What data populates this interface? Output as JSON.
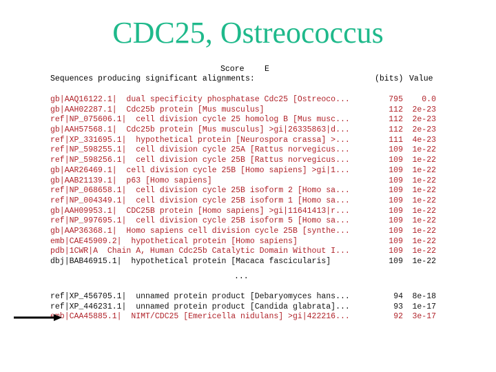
{
  "title": "CDC25, Ostreococcus",
  "header": {
    "line1_score": "Score",
    "line1_e": "E",
    "line2_label": "Sequences producing significant alignments:",
    "line2_bits": "(bits)",
    "line2_value": "Value"
  },
  "colors": {
    "title": "#1fb98b",
    "highlight": "#b0232a",
    "normal": "#111111"
  },
  "hits": [
    {
      "acc": "gb|AAQ16122.1|  dual specificity phosphatase Cdc25 [Ostreoco...",
      "bits": "795",
      "evalue": "0.0",
      "color": "red"
    },
    {
      "acc": "gb|AAH02287.1|  Cdc25b protein [Mus musculus]",
      "bits": "112",
      "evalue": "2e-23",
      "color": "red"
    },
    {
      "acc": "ref|NP_075606.1|  cell division cycle 25 homolog B [Mus musc...",
      "bits": "112",
      "evalue": "2e-23",
      "color": "red"
    },
    {
      "acc": "gb|AAH57568.1|  Cdc25b protein [Mus musculus] >gi|26335863|d...",
      "bits": "112",
      "evalue": "2e-23",
      "color": "red"
    },
    {
      "acc": "ref|XP_331695.1|  hypothetical protein [Neurospora crassa] >...",
      "bits": "111",
      "evalue": "4e-23",
      "color": "red"
    },
    {
      "acc": "ref|NP_598255.1|  cell division cycle 25A [Rattus norvegicus...",
      "bits": "109",
      "evalue": "1e-22",
      "color": "red"
    },
    {
      "acc": "ref|NP_598256.1|  cell division cycle 25B [Rattus norvegicus...",
      "bits": "109",
      "evalue": "1e-22",
      "color": "red"
    },
    {
      "acc": "gb|AAR26469.1|  cell division cycle 25B [Homo sapiens] >gi|1...",
      "bits": "109",
      "evalue": "1e-22",
      "color": "red"
    },
    {
      "acc": "gb|AAB21139.1|  p63 [Homo sapiens]",
      "bits": "109",
      "evalue": "1e-22",
      "color": "red"
    },
    {
      "acc": "ref|NP_068658.1|  cell division cycle 25B isoform 2 [Homo sa...",
      "bits": "109",
      "evalue": "1e-22",
      "color": "red"
    },
    {
      "acc": "ref|NP_004349.1|  cell division cycle 25B isoform 1 [Homo sa...",
      "bits": "109",
      "evalue": "1e-22",
      "color": "red"
    },
    {
      "acc": "gb|AAH09953.1|  CDC25B protein [Homo sapiens] >gi|11641413|r...",
      "bits": "109",
      "evalue": "1e-22",
      "color": "red"
    },
    {
      "acc": "ref|NP_997695.1|  cell division cycle 25B isoform 5 [Homo sa...",
      "bits": "109",
      "evalue": "1e-22",
      "color": "red"
    },
    {
      "acc": "gb|AAP36368.1|  Homo sapiens cell division cycle 25B [synthe...",
      "bits": "109",
      "evalue": "1e-22",
      "color": "red"
    },
    {
      "acc": "emb|CAE45909.2|  hypothetical protein [Homo sapiens]",
      "bits": "109",
      "evalue": "1e-22",
      "color": "red"
    },
    {
      "acc": "pdb|1CWR|A  Chain A, Human Cdc25b Catalytic Domain Without I...",
      "bits": "109",
      "evalue": "1e-22",
      "color": "red"
    },
    {
      "acc": "dbj|BAB46915.1|  hypothetical protein [Macaca fascicularis]",
      "bits": "109",
      "evalue": "1e-22",
      "color": "black"
    }
  ],
  "ellipsis": "...",
  "hits_tail": [
    {
      "acc": "ref|XP_456705.1|  unnamed protein product [Debaryomyces hans...",
      "bits": "94",
      "evalue": "8e-18",
      "color": "black"
    },
    {
      "acc": "ref|XP_446231.1|  unnamed protein product [Candida glabrata]...",
      "bits": "93",
      "evalue": "1e-17",
      "color": "black"
    },
    {
      "acc": "emb|CAA45885.1|  NIMT/CDC25 [Emericella nidulans] >gi|422216...",
      "bits": "92",
      "evalue": "3e-17",
      "color": "red"
    }
  ],
  "arrow": {
    "icon": "arrow-right-icon",
    "points_to": "emb|CAA45885.1|"
  }
}
